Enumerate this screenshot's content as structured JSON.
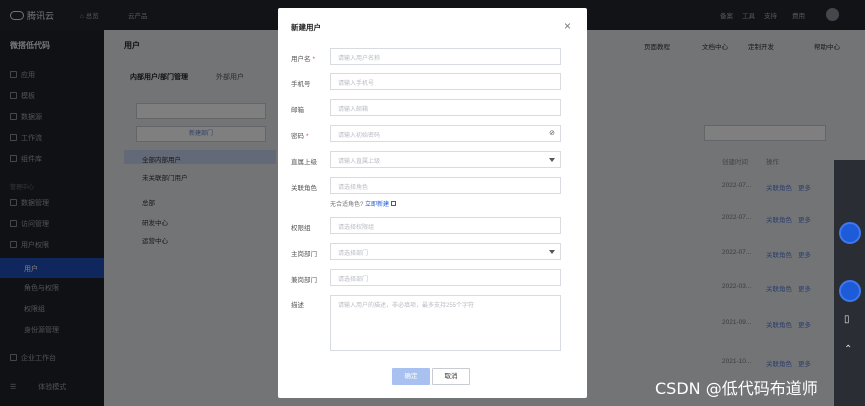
{
  "topbar": {
    "brand": "腾讯云",
    "home": "总览",
    "products": "云产品",
    "right_items": [
      "备案",
      "工具",
      "支持",
      "费用"
    ]
  },
  "sidebar": {
    "title": "微搭低代码",
    "items": [
      "应用",
      "模板",
      "数据源",
      "工作流",
      "组件库"
    ],
    "section": "管理中心",
    "items2": [
      "数据管理",
      "访问管理",
      "用户权限"
    ],
    "active": "用户",
    "subitems": [
      "角色与权限",
      "权限组",
      "身份源管理"
    ],
    "footer_items": [
      "企业工作台",
      "体验模式"
    ]
  },
  "main": {
    "page_title": "用户",
    "tabs": [
      "内部用户/部门管理",
      "外部用户"
    ],
    "new_dept": "新建部门",
    "tree": [
      "全部内部用户",
      "未关联部门用户",
      "总部",
      "研发中心",
      "运营中心"
    ],
    "toolbar": [
      "页面教程",
      "文档中心",
      "定制开发",
      "帮助中心"
    ],
    "col_headers": [
      "创建时间",
      "操作"
    ],
    "row_dates": [
      "2022-07...",
      "2022-07...",
      "2022-07...",
      "2022-03...",
      "2021-09...",
      "2021-10..."
    ],
    "row_action": "关联角色",
    "row_more": "更多"
  },
  "modal": {
    "title": "新建用户",
    "fields": {
      "username": {
        "label": "用户名",
        "placeholder": "请输入用户名称"
      },
      "phone": {
        "label": "手机号",
        "placeholder": "请输入手机号"
      },
      "email": {
        "label": "邮箱",
        "placeholder": "请输入邮箱"
      },
      "password": {
        "label": "密码",
        "placeholder": "请输入初始密码"
      },
      "manager": {
        "label": "直属上级",
        "placeholder": "请输入直属上级"
      },
      "roles": {
        "label": "关联角色",
        "placeholder": "请选择角色"
      },
      "permgroup": {
        "label": "权限组",
        "placeholder": "请选择权限组"
      },
      "main_dept": {
        "label": "主岗部门",
        "placeholder": "请选择部门"
      },
      "other_dept": {
        "label": "兼岗部门",
        "placeholder": "请选择部门"
      },
      "desc": {
        "label": "描述",
        "placeholder": "请输入用户的描述，非必填项，最多支持255个字符"
      }
    },
    "roles_hint": "无合适角色?",
    "roles_hint_link": "立即新建",
    "confirm": "确定",
    "cancel": "取消"
  },
  "watermark": "CSDN @低代码布道师"
}
